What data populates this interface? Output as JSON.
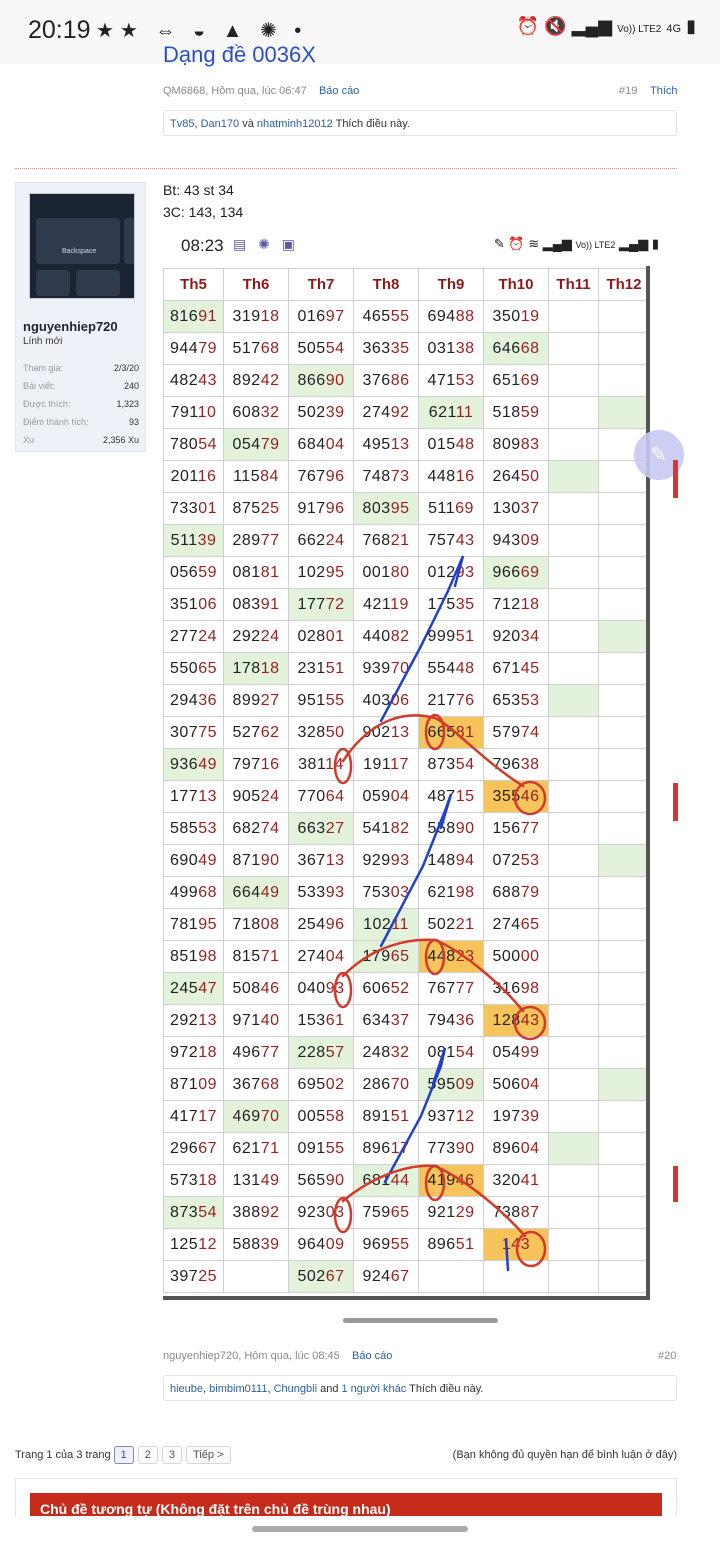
{
  "status_bar": {
    "time": "20:19",
    "network": "Vo)) LTE2",
    "net_type": "4G"
  },
  "thread_title": "Dạng đề 0036X",
  "post19": {
    "meta": "QM6868, Hôm qua, lúc 06:47",
    "report": "Báo cáo",
    "num": "#19",
    "like": "Thích",
    "liked_by": [
      "Tv85",
      "Dan170",
      "nhatminh12012"
    ],
    "and": "và",
    "likes_text": "Thích điều này."
  },
  "user": {
    "name": "nguyenhiep720",
    "title": "Lính mới",
    "avatar_key_label": "Backspace",
    "stats": [
      {
        "label": "Tham gia:",
        "value": "2/3/20"
      },
      {
        "label": "Bài viết:",
        "value": "240"
      },
      {
        "label": "Được thích:",
        "value": "1,323"
      },
      {
        "label": "Điểm thành tích:",
        "value": "93"
      },
      {
        "label": "Xu",
        "value": "2,356 Xu"
      }
    ]
  },
  "post20": {
    "line1": "Bt: 43 st 34",
    "line2": "3C: 143, 134",
    "meta": "nguyenhiep720, Hôm qua, lúc 08:45",
    "report": "Báo cáo",
    "num": "#20",
    "liked_by": [
      "hieube",
      "bimbim0111",
      "Chungbii"
    ],
    "and": "and",
    "others": "1 người khác",
    "likes_text": "Thích điều này."
  },
  "screenshot": {
    "time": "08:23",
    "network": "Vo)) LTE2"
  },
  "grid": {
    "headers": [
      "Th5",
      "Th6",
      "Th7",
      "Th8",
      "Th9",
      "Th10",
      "Th11",
      "Th12"
    ],
    "rows": [
      [
        "81691",
        "31918",
        "01697",
        "46555",
        "69488",
        "35019",
        "",
        ""
      ],
      [
        "94479",
        "51768",
        "50554",
        "36335",
        "03138",
        "64668",
        "",
        ""
      ],
      [
        "48243",
        "89242",
        "86690",
        "37686",
        "47153",
        "65169",
        "",
        ""
      ],
      [
        "79110",
        "60832",
        "50239",
        "27492",
        "62111",
        "51859",
        "",
        ""
      ],
      [
        "78054",
        "05479",
        "68404",
        "49513",
        "01548",
        "80983",
        "",
        ""
      ],
      [
        "20116",
        "11584",
        "76796",
        "74873",
        "44816",
        "26450",
        "",
        ""
      ],
      [
        "73301",
        "87525",
        "91796",
        "80395",
        "51169",
        "13037",
        "",
        ""
      ],
      [
        "51139",
        "28977",
        "66224",
        "76821",
        "75743",
        "94309",
        "",
        ""
      ],
      [
        "05659",
        "08181",
        "10295",
        "00180",
        "01293",
        "96669",
        "",
        ""
      ],
      [
        "35106",
        "08391",
        "17772",
        "42119",
        "17535",
        "71218",
        "",
        ""
      ],
      [
        "27724",
        "29224",
        "02801",
        "44082",
        "99951",
        "92034",
        "",
        ""
      ],
      [
        "55065",
        "17818",
        "23151",
        "93970",
        "55448",
        "67145",
        "",
        ""
      ],
      [
        "29436",
        "89927",
        "95155",
        "40306",
        "21776",
        "65353",
        "",
        ""
      ],
      [
        "30775",
        "52762",
        "32850",
        "90213",
        "66581",
        "57974",
        "",
        ""
      ],
      [
        "93649",
        "79716",
        "38114",
        "19117",
        "87354",
        "79638",
        "",
        ""
      ],
      [
        "17713",
        "90524",
        "77064",
        "05904",
        "48715",
        "35546",
        "",
        ""
      ],
      [
        "58553",
        "68274",
        "66327",
        "54182",
        "55890",
        "15677",
        "",
        ""
      ],
      [
        "69049",
        "87190",
        "36713",
        "92993",
        "14894",
        "07253",
        "",
        ""
      ],
      [
        "49968",
        "66449",
        "53393",
        "75303",
        "62198",
        "68879",
        "",
        ""
      ],
      [
        "78195",
        "71808",
        "25496",
        "10211",
        "50221",
        "27465",
        "",
        ""
      ],
      [
        "85198",
        "81571",
        "27404",
        "17965",
        "44823",
        "50000",
        "",
        ""
      ],
      [
        "24547",
        "50846",
        "04093",
        "60652",
        "76777",
        "31698",
        "",
        ""
      ],
      [
        "29213",
        "97140",
        "15361",
        "63437",
        "79436",
        "12843",
        "",
        ""
      ],
      [
        "97218",
        "49677",
        "22857",
        "24832",
        "08154",
        "05499",
        "",
        ""
      ],
      [
        "87109",
        "36768",
        "69502",
        "28670",
        "59509",
        "50604",
        "",
        ""
      ],
      [
        "41717",
        "46970",
        "00558",
        "89151",
        "93712",
        "19739",
        "",
        ""
      ],
      [
        "29667",
        "62171",
        "09155",
        "89617",
        "77390",
        "89604",
        "",
        ""
      ],
      [
        "57318",
        "13149",
        "56590",
        "68144",
        "41946",
        "32041",
        "",
        ""
      ],
      [
        "87354",
        "38892",
        "92303",
        "75965",
        "92129",
        "73887",
        "",
        ""
      ],
      [
        "12512",
        "58839",
        "96409",
        "96955",
        "89651",
        "143",
        "",
        ""
      ],
      [
        "39725",
        "",
        "50267",
        "92467",
        "",
        "",
        "",
        ""
      ]
    ]
  },
  "pager": {
    "label": "Trang 1 của 3 trang",
    "pages": [
      "1",
      "2",
      "3"
    ],
    "next": "Tiếp >"
  },
  "no_permission": "(Bạn không đủ quyền hạn để bình luận ở đây)",
  "similar_title": "Chủ đề tương tự (Không đặt trên chủ đề trùng nhau)"
}
